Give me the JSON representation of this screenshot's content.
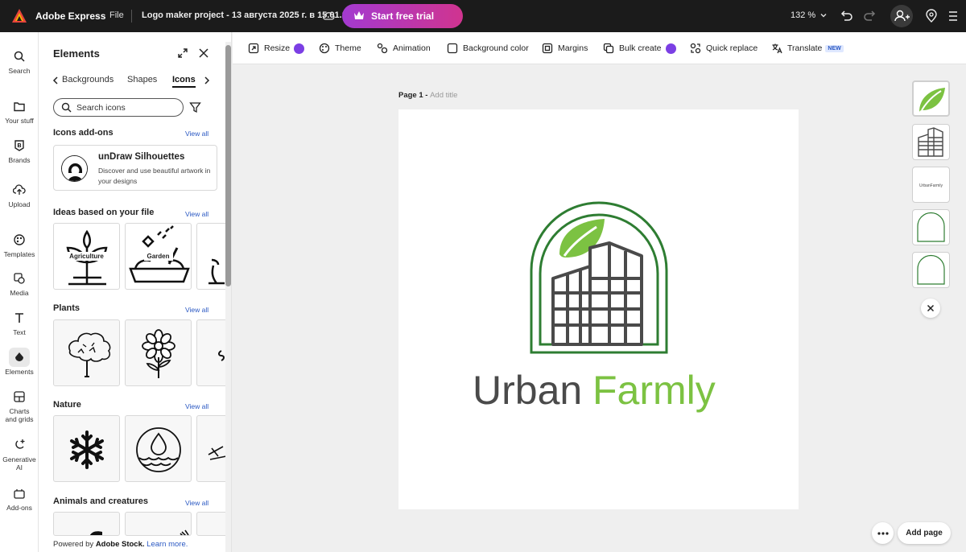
{
  "topbar": {
    "app_name": "Adobe Express",
    "file_menu": "File",
    "project_title": "Logo maker project - 13 августа 2025 г. в 15.01.11",
    "trial_button": "Start free trial",
    "zoom": "132 %"
  },
  "rail": {
    "items": [
      {
        "label": "Search",
        "icon": "search-icon"
      },
      {
        "label": "Your stuff",
        "icon": "folder-icon"
      },
      {
        "label": "Brands",
        "icon": "brand-icon"
      },
      {
        "label": "Upload",
        "icon": "upload-icon"
      },
      {
        "label": "Templates",
        "icon": "templates-icon"
      },
      {
        "label": "Media",
        "icon": "media-icon"
      },
      {
        "label": "Text",
        "icon": "text-icon"
      },
      {
        "label": "Elements",
        "icon": "elements-icon",
        "active": true
      },
      {
        "label": "Charts and grids",
        "icon": "charts-icon"
      },
      {
        "label": "Generative AI",
        "icon": "generative-ai-icon"
      },
      {
        "label": "Add-ons",
        "icon": "add-ons-icon"
      }
    ]
  },
  "panel": {
    "title": "Elements",
    "tabs": [
      "Backgrounds",
      "Shapes",
      "Icons"
    ],
    "active_tab": "Icons",
    "search_placeholder": "Search icons",
    "sections": {
      "addons": {
        "title": "Icons add-ons",
        "view_all": "View all"
      },
      "ideas": {
        "title": "Ideas based on your file",
        "view_all": "View all",
        "tiles": [
          "Agriculture",
          "Garden"
        ]
      },
      "plants": {
        "title": "Plants",
        "view_all": "View all"
      },
      "nature": {
        "title": "Nature",
        "view_all": "View all"
      },
      "animals": {
        "title": "Animals and creatures",
        "view_all": "View all"
      }
    },
    "addon_card": {
      "name": "unDraw Silhouettes",
      "description": "Discover and use beautiful artwork in your designs"
    },
    "powered_prefix": "Powered by ",
    "powered_brand": "Adobe Stock.",
    "learn_more": "Learn more."
  },
  "toolbar": {
    "items": [
      "Resize",
      "Theme",
      "Animation",
      "Background color",
      "Margins",
      "Bulk create",
      "Quick replace",
      "Translate"
    ],
    "translate_badge": "NEW"
  },
  "canvas": {
    "page_label": "Page 1 -",
    "add_title": "Add title",
    "logo_word_1": "Urban",
    "logo_word_2": "Farmly",
    "thumb_text": "UrbanFarmly"
  },
  "bottom": {
    "add_page": "Add page"
  },
  "colors": {
    "dark_green": "#2e7d32",
    "leaf_green": "#7cc242",
    "building_gray": "#4a4a4a",
    "accent_purple": "#7b3fe4",
    "link_blue": "#2b59c3"
  }
}
